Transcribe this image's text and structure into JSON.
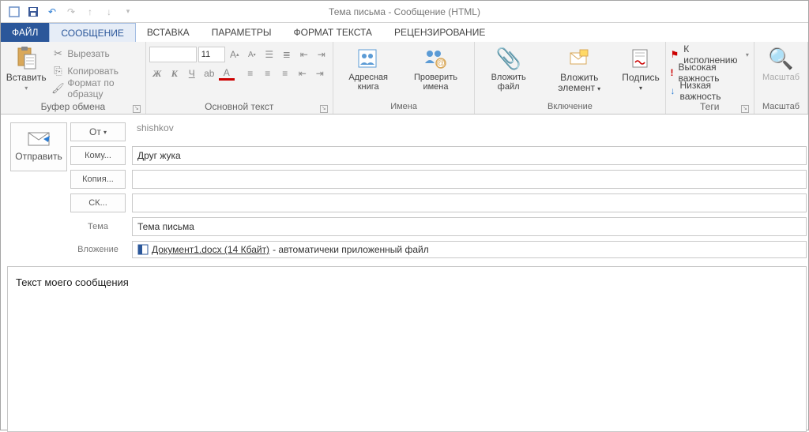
{
  "title": "Тема письма - Сообщение (HTML)",
  "tabs": {
    "file": "ФАЙЛ",
    "message": "СООБЩЕНИЕ",
    "insert": "ВСТАВКА",
    "options": "ПАРАМЕТРЫ",
    "format": "ФОРМАТ ТЕКСТА",
    "review": "РЕЦЕНЗИРОВАНИЕ"
  },
  "ribbon": {
    "paste": "Вставить",
    "cut": "Вырезать",
    "copy": "Копировать",
    "format_painter": "Формат по образцу",
    "clipboard_group": "Буфер обмена",
    "font_size": "11",
    "font_group": "Основной текст",
    "address_book": "Адресная книга",
    "check_names": "Проверить имена",
    "names_group": "Имена",
    "attach_file": "Вложить файл",
    "attach_item": "Вложить элемент",
    "signature": "Подпись",
    "include_group": "Включение",
    "follow_up": "К исполнению",
    "high_importance": "Высокая важность",
    "low_importance": "Низкая важность",
    "tags_group": "Теги",
    "zoom": "Масштаб",
    "zoom_group": "Масштаб"
  },
  "compose": {
    "send": "Отправить",
    "from_btn": "От",
    "from_val": "shishkov",
    "to_btn": "Кому...",
    "to_val": "Друг жука",
    "cc_btn": "Копия...",
    "cc_val": "",
    "bcc_btn": "СК...",
    "bcc_val": "",
    "subject_lbl": "Тема",
    "subject_val": "Тема письма",
    "attach_lbl": "Вложение",
    "attach_name": "Документ1.docx (14 Кбайт)",
    "attach_note": " - автоматичеки приложенный файл"
  },
  "body": "Текст моего сообщения"
}
